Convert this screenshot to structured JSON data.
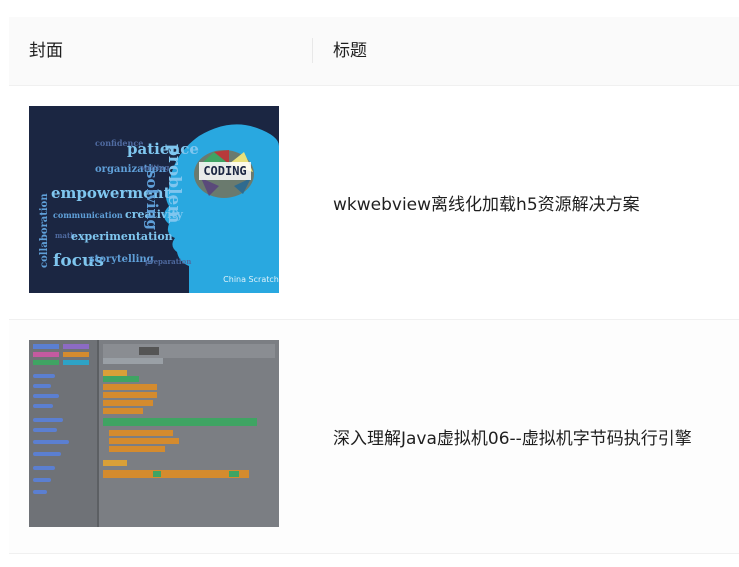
{
  "table": {
    "columns": {
      "cover": "封面",
      "title": "标题"
    },
    "rows": [
      {
        "title": "wkwebview离线化加载h5资源解决方案",
        "cover": {
          "kind": "coding-poster",
          "words": [
            "confidence",
            "patience",
            "organization",
            "writing",
            "empowerment",
            "communication",
            "creativity",
            "math",
            "experimentation",
            "focus",
            "storytelling",
            "preparation",
            "collaboration",
            "problem",
            "solving"
          ],
          "badge": "CODING",
          "watermark": "China Scratch"
        }
      },
      {
        "title": "深入理解Java虚拟机06--虚拟机字节码执行引擎",
        "cover": {
          "kind": "scratch-editor-screenshot"
        }
      }
    ]
  },
  "colors": {
    "header_bg": "#fafafa",
    "border": "#f0f0f0",
    "poster_bg": "#1b2642",
    "poster_head": "#29a8e0",
    "scratch_bg": "#7b7e83"
  }
}
